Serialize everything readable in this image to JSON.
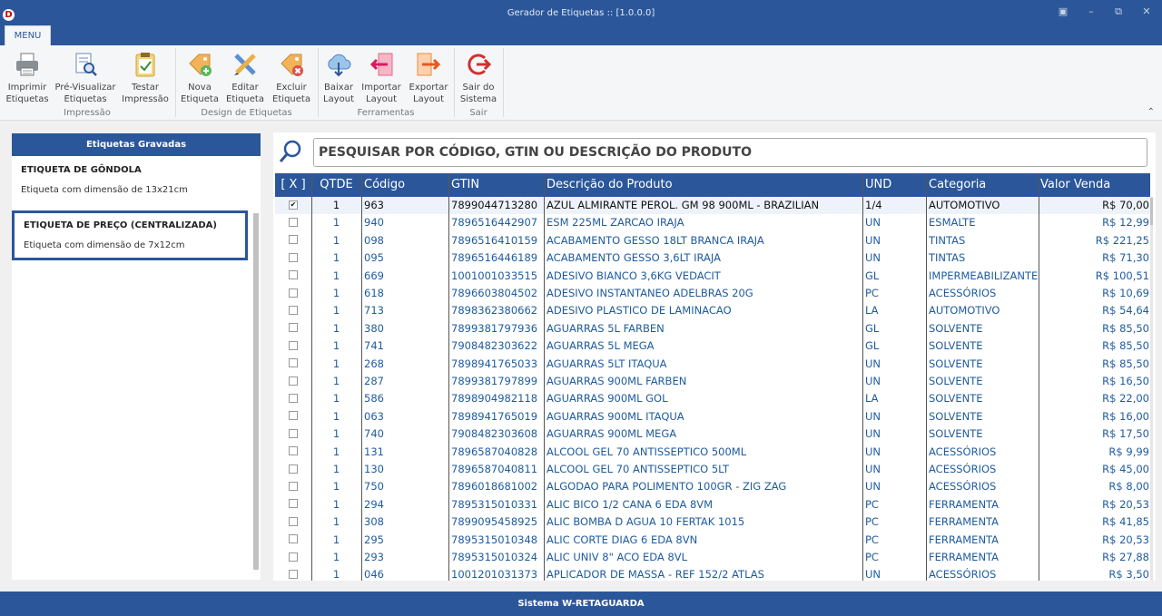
{
  "app": {
    "title": "Gerador de Etiquetas :: [1.0.0.0]",
    "icon_letter": "D"
  },
  "window_controls": [
    "restore-icon",
    "minimize-icon",
    "maximize-icon",
    "close-icon"
  ],
  "ribbon": {
    "tab": "MENU",
    "buttons": [
      {
        "line1": "Imprimir",
        "line2": "Etiquetas",
        "icon": "printer-icon"
      },
      {
        "line1": "Pré-Visualizar",
        "line2": "Etiquetas",
        "icon": "preview-icon"
      },
      {
        "line1": "Testar",
        "line2": "Impressão",
        "icon": "clipboard-check-icon"
      },
      {
        "line1": "Nova",
        "line2": "Etiqueta",
        "icon": "tag-add-icon"
      },
      {
        "line1": "Editar",
        "line2": "Etiqueta",
        "icon": "pencil-ruler-icon"
      },
      {
        "line1": "Excluir",
        "line2": "Etiqueta",
        "icon": "tag-delete-icon"
      },
      {
        "line1": "Baixar",
        "line2": "Layout",
        "icon": "cloud-download-icon"
      },
      {
        "line1": "Importar",
        "line2": "Layout",
        "icon": "import-arrow-icon"
      },
      {
        "line1": "Exportar",
        "line2": "Layout",
        "icon": "export-arrow-icon"
      },
      {
        "line1": "Sair do",
        "line2": "Sistema",
        "icon": "exit-icon"
      }
    ],
    "groups": [
      "Impressão",
      "Design de Etiquetas",
      "Ferramentas",
      "Sair"
    ]
  },
  "left_panel": {
    "header": "Etiquetas Gravadas",
    "labels": [
      {
        "title": "ETIQUETA DE GÔNDOLA",
        "desc": "Etiqueta com dimensão de 13x21cm"
      },
      {
        "title": "ETIQUETA DE PREÇO (CENTRALIZADA)",
        "desc": "Etiqueta com dimensão de 7x12cm"
      }
    ]
  },
  "search": {
    "placeholder": "PESQUISAR POR CÓDIGO, GTIN OU DESCRIÇÃO DO PRODUTO"
  },
  "table": {
    "columns": [
      "[ X ]",
      "QTDE",
      "Código",
      "GTIN",
      "Descrição do Produto",
      "UND",
      "Categoria",
      "Valor Venda"
    ],
    "rows": [
      {
        "checked": true,
        "qtde": "1",
        "codigo": "963",
        "gtin": "7899044713280",
        "descricao": " AZUL ALMIRANTE PEROL. GM 98 900ML - BRAZILIAN",
        "und": "1/4",
        "categoria": "AUTOMOTIVO",
        "valor": "R$ 70,00"
      },
      {
        "checked": false,
        "qtde": "1",
        "codigo": "940",
        "gtin": "7896516442907",
        "descricao": " ESM 225ML  ZARCAO IRAJA",
        "und": "UN",
        "categoria": "ESMALTE",
        "valor": "R$ 12,99"
      },
      {
        "checked": false,
        "qtde": "1",
        "codigo": "098",
        "gtin": "7896516410159",
        "descricao": "ACABAMENTO GESSO 18LT BRANCA IRAJA",
        "und": "UN",
        "categoria": "TINTAS",
        "valor": "R$ 221,25"
      },
      {
        "checked": false,
        "qtde": "1",
        "codigo": "095",
        "gtin": "7896516446189",
        "descricao": "ACABAMENTO GESSO 3,6LT IRAJA",
        "und": "UN",
        "categoria": "TINTAS",
        "valor": "R$ 71,30"
      },
      {
        "checked": false,
        "qtde": "1",
        "codigo": "669",
        "gtin": "1001001033515",
        "descricao": "ADESIVO BIANCO 3,6KG VEDACIT",
        "und": "GL",
        "categoria": "IMPERMEABILIZANTE",
        "valor": "R$ 100,51"
      },
      {
        "checked": false,
        "qtde": "1",
        "codigo": "618",
        "gtin": "7896603804502",
        "descricao": "ADESIVO INSTANTANEO ADELBRAS 20G",
        "und": "PC",
        "categoria": "ACESSÓRIOS",
        "valor": "R$ 10,69"
      },
      {
        "checked": false,
        "qtde": "1",
        "codigo": "713",
        "gtin": "7898362380662",
        "descricao": "ADESIVO PLASTICO DE LAMINACAO",
        "und": "LA",
        "categoria": "AUTOMOTIVO",
        "valor": "R$ 54,64"
      },
      {
        "checked": false,
        "qtde": "1",
        "codigo": "380",
        "gtin": "7899381797936",
        "descricao": "AGUARRAS 5L FARBEN",
        "und": "GL",
        "categoria": "SOLVENTE",
        "valor": "R$ 85,50"
      },
      {
        "checked": false,
        "qtde": "1",
        "codigo": "741",
        "gtin": "7908482303622",
        "descricao": "AGUARRAS 5L MEGA",
        "und": "GL",
        "categoria": "SOLVENTE",
        "valor": "R$ 85,50"
      },
      {
        "checked": false,
        "qtde": "1",
        "codigo": "268",
        "gtin": "7898941765033",
        "descricao": "AGUARRAS 5LT ITAQUA",
        "und": "UN",
        "categoria": "SOLVENTE",
        "valor": "R$ 85,50"
      },
      {
        "checked": false,
        "qtde": "1",
        "codigo": "287",
        "gtin": "7899381797899",
        "descricao": "AGUARRAS 900ML FARBEN",
        "und": "UN",
        "categoria": "SOLVENTE",
        "valor": "R$ 16,50"
      },
      {
        "checked": false,
        "qtde": "1",
        "codigo": "586",
        "gtin": "7898904982118",
        "descricao": "AGUARRAS 900ML GOL",
        "und": "LA",
        "categoria": "SOLVENTE",
        "valor": "R$ 22,00"
      },
      {
        "checked": false,
        "qtde": "1",
        "codigo": "063",
        "gtin": "7898941765019",
        "descricao": "AGUARRAS 900ML ITAQUA",
        "und": "UN",
        "categoria": "SOLVENTE",
        "valor": "R$ 16,00"
      },
      {
        "checked": false,
        "qtde": "1",
        "codigo": "740",
        "gtin": "7908482303608",
        "descricao": "AGUARRAS 900ML MEGA",
        "und": "UN",
        "categoria": "SOLVENTE",
        "valor": "R$ 17,50"
      },
      {
        "checked": false,
        "qtde": "1",
        "codigo": "131",
        "gtin": "7896587040828",
        "descricao": "ALCOOL GEL 70 ANTISSEPTICO 500ML",
        "und": "UN",
        "categoria": "ACESSÓRIOS",
        "valor": "R$ 9,99"
      },
      {
        "checked": false,
        "qtde": "1",
        "codigo": "130",
        "gtin": "7896587040811",
        "descricao": "ALCOOL GEL 70 ANTISSEPTICO 5LT",
        "und": "UN",
        "categoria": "ACESSÓRIOS",
        "valor": "R$ 45,00"
      },
      {
        "checked": false,
        "qtde": "1",
        "codigo": "750",
        "gtin": "7896018681002",
        "descricao": "ALGODAO PARA POLIMENTO 100GR -  ZIG ZAG",
        "und": "UN",
        "categoria": "ACESSÓRIOS",
        "valor": "R$ 8,00"
      },
      {
        "checked": false,
        "qtde": "1",
        "codigo": "294",
        "gtin": "7895315010331",
        "descricao": "ALIC BICO 1/2 CANA 6 EDA 8VM",
        "und": "PC",
        "categoria": "FERRAMENTA",
        "valor": "R$ 20,53"
      },
      {
        "checked": false,
        "qtde": "1",
        "codigo": "308",
        "gtin": "7899095458925",
        "descricao": "ALIC BOMBA D AGUA 10 FERTAK 1015",
        "und": "PC",
        "categoria": "FERRAMENTA",
        "valor": "R$ 41,85"
      },
      {
        "checked": false,
        "qtde": "1",
        "codigo": "295",
        "gtin": "7895315010348",
        "descricao": "ALIC CORTE DIAG 6 EDA 8VN",
        "und": "PC",
        "categoria": "FERRAMENTA",
        "valor": "R$ 20,53"
      },
      {
        "checked": false,
        "qtde": "1",
        "codigo": "293",
        "gtin": "7895315010324",
        "descricao": "ALIC UNIV 8\" ACO EDA 8VL",
        "und": "PC",
        "categoria": "FERRAMENTA",
        "valor": "R$ 27,88"
      },
      {
        "checked": false,
        "qtde": "1",
        "codigo": "046",
        "gtin": "1001201031373",
        "descricao": "APLICADOR DE MASSA - REF 152/2 ATLAS",
        "und": "UN",
        "categoria": "ACESSÓRIOS",
        "valor": "R$ 3,50"
      }
    ]
  },
  "status": "Sistema W-RETAGUARDA",
  "colors": {
    "primary": "#2b579a",
    "row_text": "#1e5b9e"
  }
}
